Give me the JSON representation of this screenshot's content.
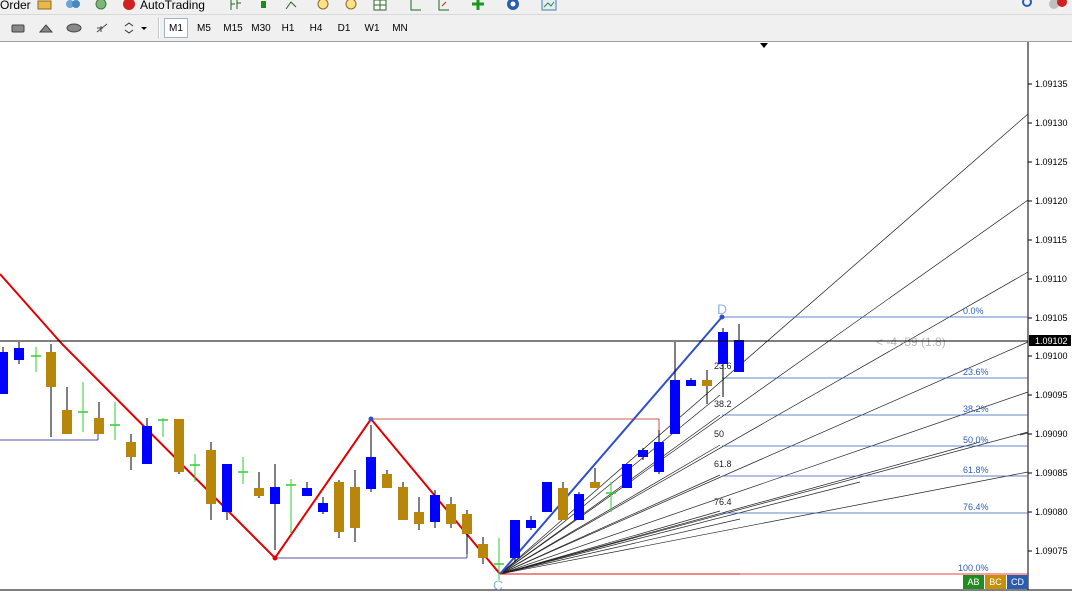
{
  "toolbar_top": {
    "order_label": "Order",
    "autotrading_label": "AutoTrading"
  },
  "timeframes": [
    "M1",
    "M5",
    "M15",
    "M30",
    "H1",
    "H4",
    "D1",
    "W1",
    "MN"
  ],
  "active_timeframe": "M1",
  "price_axis": {
    "labels": [
      "1.09135",
      "1.09130",
      "1.09125",
      "1.09120",
      "1.09115",
      "1.09110",
      "1.09105",
      "1.09100",
      "1.09095",
      "1.09090",
      "1.09085",
      "1.09080",
      "1.09075"
    ],
    "current_price": "1.09102"
  },
  "fib_levels": [
    "0.0%",
    "23.6%",
    "38.2%",
    "50.0%",
    "61.8%",
    "76.4%",
    "100.0%"
  ],
  "fan_labels": [
    "23.6",
    "38.2",
    "50",
    "61.8",
    "76.4"
  ],
  "pattern_points": {
    "c": "C",
    "d": "D"
  },
  "ratio_text": "< -4 -59 (1.8)",
  "tags": [
    "AB",
    "BC",
    "CD"
  ],
  "colors": {
    "bull": "#0000ff",
    "bear": "#b8860b",
    "doji": "#32cd32",
    "zigzag": "#e00000",
    "fib": "#2f5fb8",
    "tag_ab": "#228b22",
    "tag_bc": "#c8900a",
    "tag_cd": "#2a5db0"
  }
}
